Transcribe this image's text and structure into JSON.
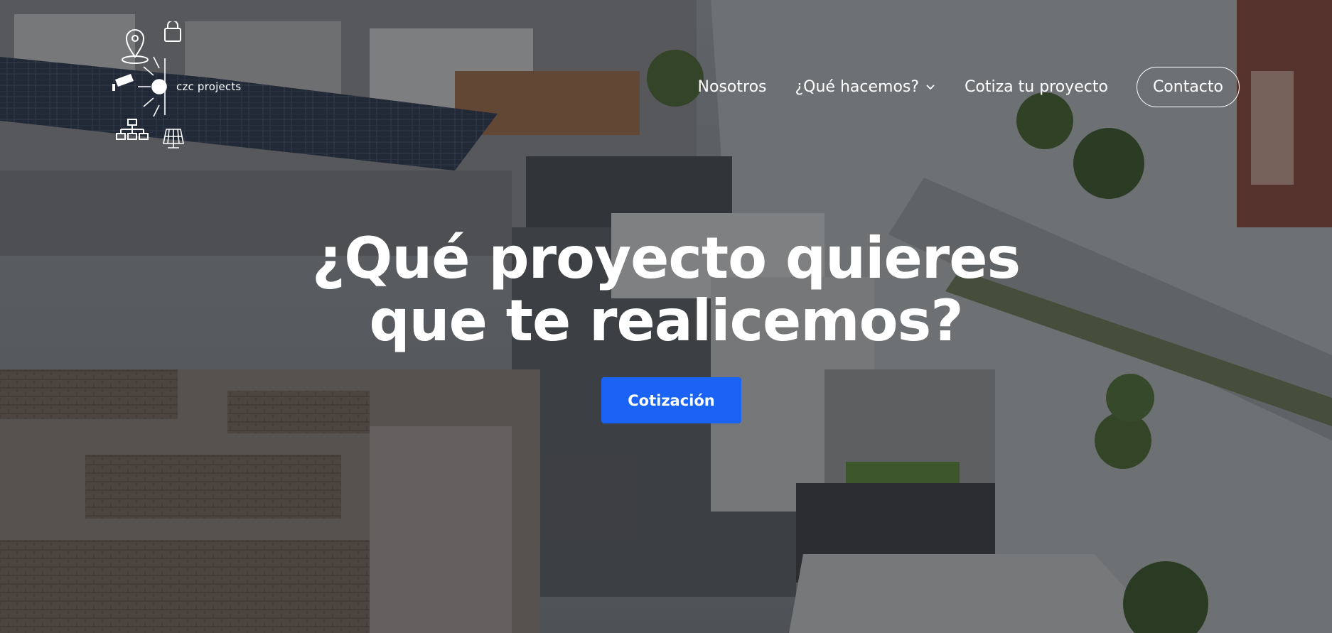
{
  "brand": {
    "name": "czc projects"
  },
  "nav": {
    "items": [
      {
        "label": "Nosotros"
      },
      {
        "label": "¿Qué hacemos?"
      },
      {
        "label": "Cotiza tu proyecto"
      }
    ],
    "contact_label": "Contacto"
  },
  "hero": {
    "headline_line1": "¿Qué proyecto quieres",
    "headline_line2": "que te realicemos?",
    "cta_label": "Cotización"
  },
  "colors": {
    "accent": "#1a63f5",
    "text": "#ffffff"
  },
  "icons": [
    "location-pin-icon",
    "lock-icon",
    "cctv-camera-icon",
    "network-icon",
    "solar-panel-icon",
    "chevron-down-icon"
  ]
}
